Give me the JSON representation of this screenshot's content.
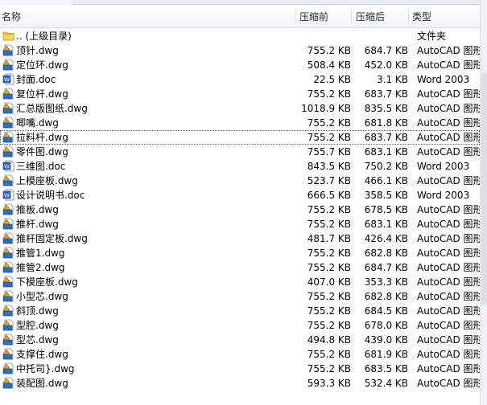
{
  "header": {
    "name": "名称",
    "original": "压缩前",
    "compressed": "压缩后",
    "type": "类型"
  },
  "rows": [
    {
      "name": ".. (上级目录)",
      "original": "",
      "compressed": "",
      "type": "文件夹",
      "icon": "folder-icon"
    },
    {
      "name": "顶针.dwg",
      "original": "755.2 KB",
      "compressed": "684.7 KB",
      "type": "AutoCAD 图形",
      "icon": "autocad-file-icon"
    },
    {
      "name": "定位环.dwg",
      "original": "508.4 KB",
      "compressed": "452.0 KB",
      "type": "AutoCAD 图形",
      "icon": "autocad-file-icon"
    },
    {
      "name": "封面.doc",
      "original": "22.5 KB",
      "compressed": "3.1 KB",
      "type": "Word 2003",
      "icon": "word-file-icon"
    },
    {
      "name": "复位杆.dwg",
      "original": "755.2 KB",
      "compressed": "683.7 KB",
      "type": "AutoCAD 图形",
      "icon": "autocad-file-icon"
    },
    {
      "name": "汇总版图纸.dwg",
      "original": "1018.9 KB",
      "compressed": "835.5 KB",
      "type": "AutoCAD 图形",
      "icon": "autocad-file-icon"
    },
    {
      "name": "唧嘴.dwg",
      "original": "755.2 KB",
      "compressed": "681.8 KB",
      "type": "AutoCAD 图形",
      "icon": "autocad-file-icon"
    },
    {
      "name": "拉料杆.dwg",
      "original": "755.2 KB",
      "compressed": "683.7 KB",
      "type": "AutoCAD 图形",
      "icon": "autocad-file-icon",
      "focused": true
    },
    {
      "name": "零件图.dwg",
      "original": "755.7 KB",
      "compressed": "683.1 KB",
      "type": "AutoCAD 图形",
      "icon": "autocad-file-icon"
    },
    {
      "name": "三维图.doc",
      "original": "843.5 KB",
      "compressed": "750.2 KB",
      "type": "Word 2003",
      "icon": "word-file-icon"
    },
    {
      "name": "上模座板.dwg",
      "original": "523.7 KB",
      "compressed": "466.1 KB",
      "type": "AutoCAD 图形",
      "icon": "autocad-file-icon"
    },
    {
      "name": "设计说明书.doc",
      "original": "666.5 KB",
      "compressed": "358.5 KB",
      "type": "Word 2003",
      "icon": "word-file-icon"
    },
    {
      "name": "推板.dwg",
      "original": "755.2 KB",
      "compressed": "678.5 KB",
      "type": "AutoCAD 图形",
      "icon": "autocad-file-icon"
    },
    {
      "name": "推杆.dwg",
      "original": "755.2 KB",
      "compressed": "683.1 KB",
      "type": "AutoCAD 图形",
      "icon": "autocad-file-icon"
    },
    {
      "name": "推杆固定板.dwg",
      "original": "481.7 KB",
      "compressed": "426.4 KB",
      "type": "AutoCAD 图形",
      "icon": "autocad-file-icon"
    },
    {
      "name": "推管1.dwg",
      "original": "755.2 KB",
      "compressed": "682.8 KB",
      "type": "AutoCAD 图形",
      "icon": "autocad-file-icon"
    },
    {
      "name": "推管2.dwg",
      "original": "755.2 KB",
      "compressed": "684.7 KB",
      "type": "AutoCAD 图形",
      "icon": "autocad-file-icon"
    },
    {
      "name": "下模座板.dwg",
      "original": "407.0 KB",
      "compressed": "353.3 KB",
      "type": "AutoCAD 图形",
      "icon": "autocad-file-icon"
    },
    {
      "name": "小型芯.dwg",
      "original": "755.2 KB",
      "compressed": "682.8 KB",
      "type": "AutoCAD 图形",
      "icon": "autocad-file-icon"
    },
    {
      "name": "斜顶.dwg",
      "original": "755.2 KB",
      "compressed": "684.5 KB",
      "type": "AutoCAD 图形",
      "icon": "autocad-file-icon"
    },
    {
      "name": "型腔.dwg",
      "original": "755.2 KB",
      "compressed": "678.0 KB",
      "type": "AutoCAD 图形",
      "icon": "autocad-file-icon"
    },
    {
      "name": "型芯.dwg",
      "original": "494.8 KB",
      "compressed": "439.0 KB",
      "type": "AutoCAD 图形",
      "icon": "autocad-file-icon"
    },
    {
      "name": "支撑住.dwg",
      "original": "755.2 KB",
      "compressed": "681.9 KB",
      "type": "AutoCAD 图形",
      "icon": "autocad-file-icon"
    },
    {
      "name": "中托司}.dwg",
      "original": "755.2 KB",
      "compressed": "683.5 KB",
      "type": "AutoCAD 图形",
      "icon": "autocad-file-icon"
    },
    {
      "name": "装配图.dwg",
      "original": "593.3 KB",
      "compressed": "532.4 KB",
      "type": "AutoCAD 图形",
      "icon": "autocad-file-icon"
    }
  ]
}
